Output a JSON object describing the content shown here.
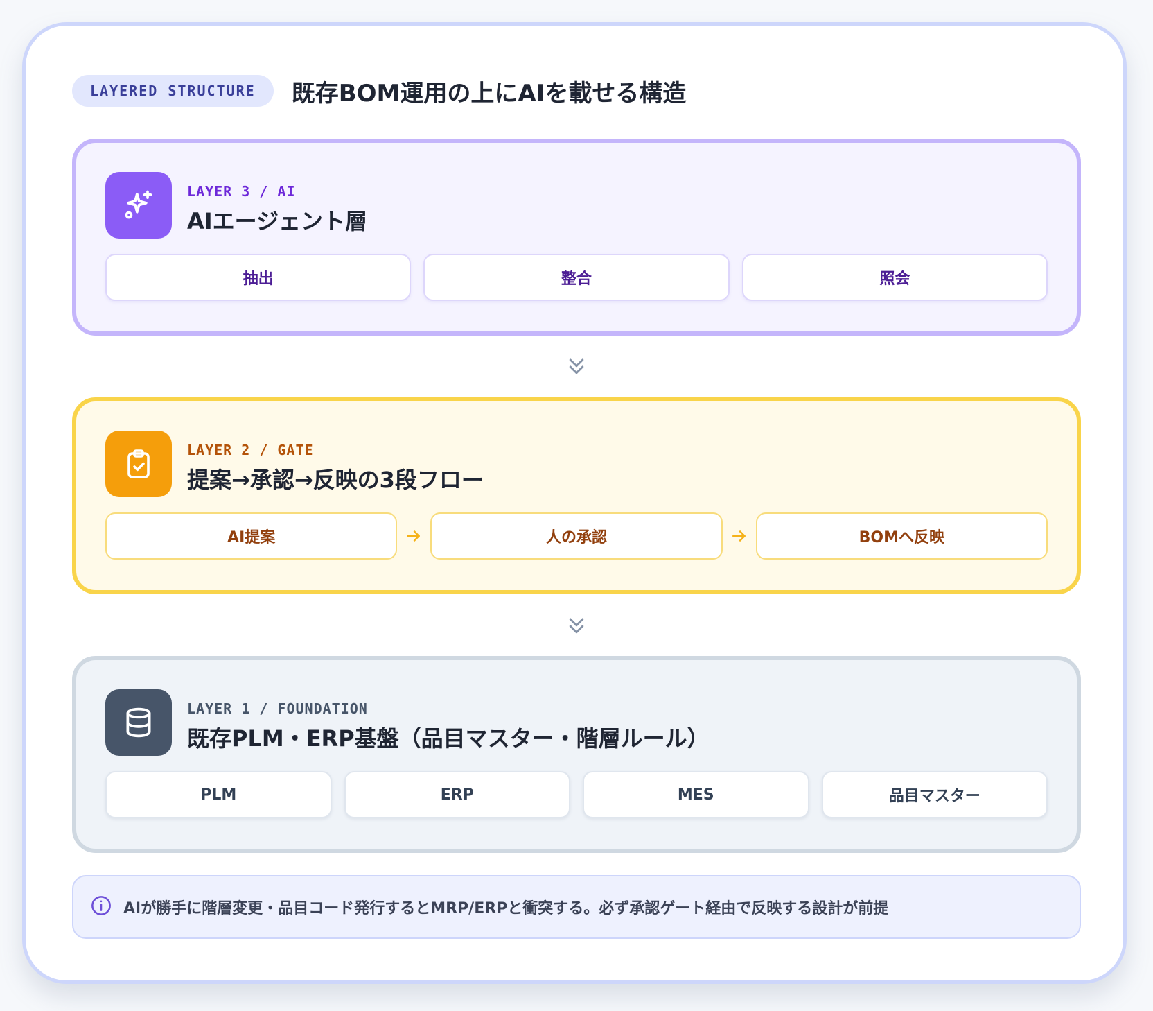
{
  "header": {
    "tag": "LAYERED STRUCTURE",
    "title": "既存BOM運用の上にAIを載せる構造"
  },
  "layers": [
    {
      "kicker": "LAYER 3 / AI",
      "title": "AIエージェント層",
      "icon": "sparkles-icon",
      "items": [
        "抽出",
        "整合",
        "照会"
      ]
    },
    {
      "kicker": "LAYER 2 / GATE",
      "title": "提案→承認→反映の3段フロー",
      "icon": "clipboard-check-icon",
      "items": [
        "AI提案",
        "人の承認",
        "BOMへ反映"
      ]
    },
    {
      "kicker": "LAYER 1 / FOUNDATION",
      "title": "既存PLM・ERP基盤（品目マスター・階層ルール）",
      "icon": "database-icon",
      "items": [
        "PLM",
        "ERP",
        "MES",
        "品目マスター"
      ]
    }
  ],
  "note": {
    "icon": "info-icon",
    "text": "AIが勝手に階層変更・品目コード発行するとMRP/ERPと衝突する。必ず承認ゲート経由で反映する設計が前提"
  },
  "colors": {
    "ai_accent": "#8b5cf6",
    "gate_accent": "#f59e0b",
    "foundation_accent": "#475569",
    "frame": "#cdd6fb"
  }
}
